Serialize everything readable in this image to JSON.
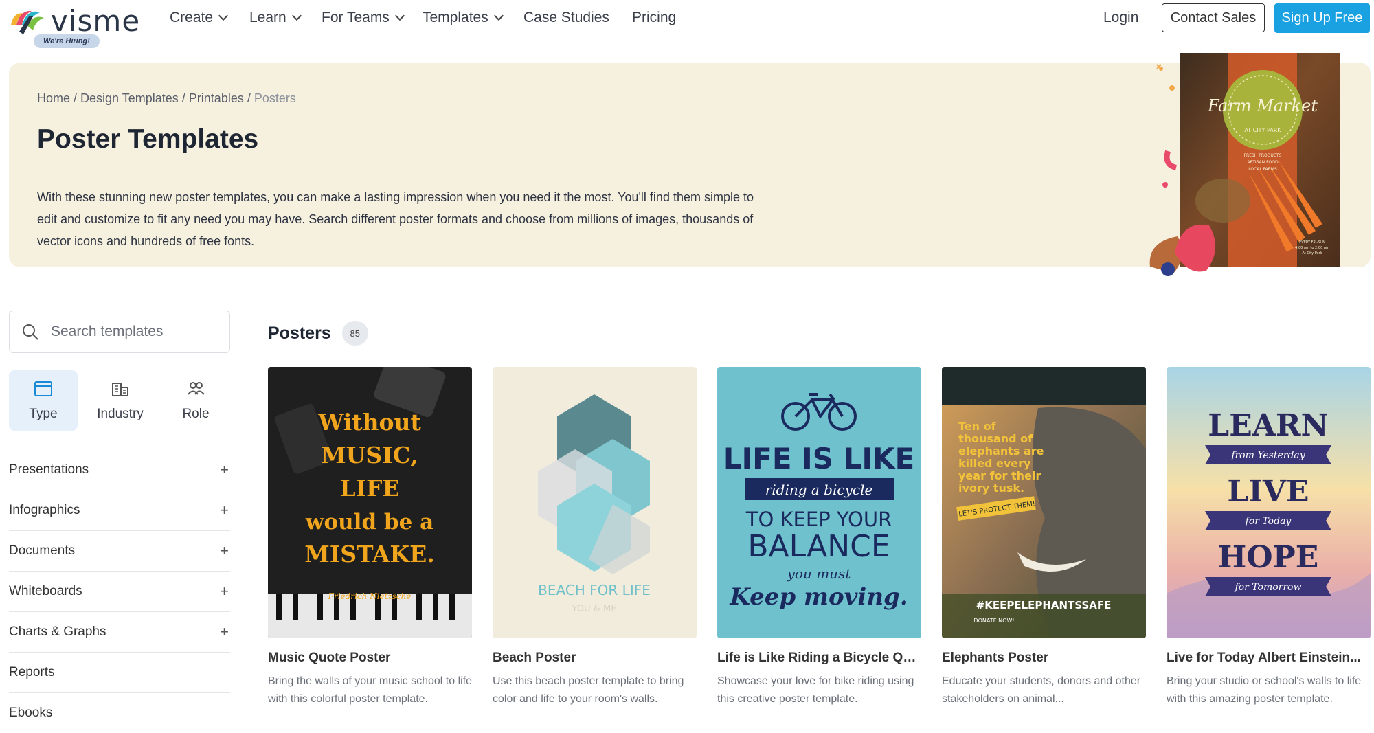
{
  "nav": {
    "logo_text": "visme",
    "hiring_badge": "We're Hiring!",
    "items": [
      {
        "label": "Create",
        "has_dropdown": true
      },
      {
        "label": "Learn",
        "has_dropdown": true
      },
      {
        "label": "For Teams",
        "has_dropdown": true
      },
      {
        "label": "Templates",
        "has_dropdown": true
      },
      {
        "label": "Case Studies",
        "has_dropdown": false
      },
      {
        "label": "Pricing",
        "has_dropdown": false
      }
    ],
    "login": "Login",
    "contact_sales": "Contact Sales",
    "sign_up": "Sign Up Free"
  },
  "hero": {
    "breadcrumb": [
      {
        "label": "Home"
      },
      {
        "label": "Design Templates"
      },
      {
        "label": "Printables"
      },
      {
        "label": "Posters"
      }
    ],
    "title": "Poster Templates",
    "description": "With these stunning new poster templates, you can make a lasting impression when you need it the most. You'll find them simple to edit and customize to fit any need you may have. Search different poster formats and choose from millions of images, thousands of vector icons and hundreds of free fonts.",
    "art": {
      "headline": "Farm Market",
      "subline": "AT CITY PARK",
      "lines": [
        "FRESH PRODUCTS",
        "ARTISAN FOOD",
        "LOCAL FARMS"
      ],
      "footer": [
        "EVERY FRI-SUN",
        "4:00 am to 2:00 pm",
        "At City Park"
      ]
    }
  },
  "sidebar": {
    "search_placeholder": "Search templates",
    "filter_tabs": [
      {
        "label": "Type",
        "icon": "window-icon",
        "active": true
      },
      {
        "label": "Industry",
        "icon": "buildings-icon",
        "active": false
      },
      {
        "label": "Role",
        "icon": "people-icon",
        "active": false
      }
    ],
    "categories": [
      {
        "label": "Presentations",
        "expandable": true
      },
      {
        "label": "Infographics",
        "expandable": true
      },
      {
        "label": "Documents",
        "expandable": true
      },
      {
        "label": "Whiteboards",
        "expandable": true
      },
      {
        "label": "Charts & Graphs",
        "expandable": true
      },
      {
        "label": "Reports",
        "expandable": false
      },
      {
        "label": "Ebooks",
        "expandable": false
      }
    ]
  },
  "main": {
    "section_title": "Posters",
    "count": "85",
    "cards": [
      {
        "title": "Music Quote Poster",
        "description": "Bring the walls of your music school to life with this colorful poster template.",
        "poster": {
          "lines": [
            "Without",
            "MUSIC,",
            "LIFE",
            "would be a",
            "MISTAKE."
          ],
          "author": "Friedrich Nietzsche"
        }
      },
      {
        "title": "Beach Poster",
        "description": "Use this beach poster template to bring color and life to your room's walls.",
        "poster": {
          "lines": [
            "BEACH FOR LIFE",
            "YOU & ME"
          ]
        }
      },
      {
        "title": "Life is Like Riding a Bicycle Quo...",
        "description": "Showcase your love for bike riding using this creative poster template.",
        "poster": {
          "lines": [
            "LIFE IS LIKE",
            "riding a bicycle",
            "TO KEEP YOUR",
            "BALANCE",
            "you must",
            "Keep moving."
          ]
        }
      },
      {
        "title": "Elephants Poster",
        "description": "Educate your students, donors and other stakeholders on animal...",
        "poster": {
          "lines": [
            "Ten of",
            "thousand of",
            "elephants are",
            "killed every",
            "year for their",
            "ivory tusk."
          ],
          "tag": "LET'S PROTECT THEM!",
          "hashtag": "#KEEPELEPHANTSSAFE",
          "donate": "DONATE NOW!"
        }
      },
      {
        "title": "Live for Today Albert Einstein...",
        "description": "Bring your studio or school's walls to life with this amazing poster template.",
        "poster": {
          "lines": [
            "LEARN",
            "from Yesterday",
            "LIVE",
            "for Today",
            "HOPE",
            "for Tomorrow"
          ]
        }
      }
    ]
  },
  "colors": {
    "accent": "#1aa1e2",
    "hero_bg": "#f6f0df",
    "active_tab_bg": "#e6f0fb"
  }
}
